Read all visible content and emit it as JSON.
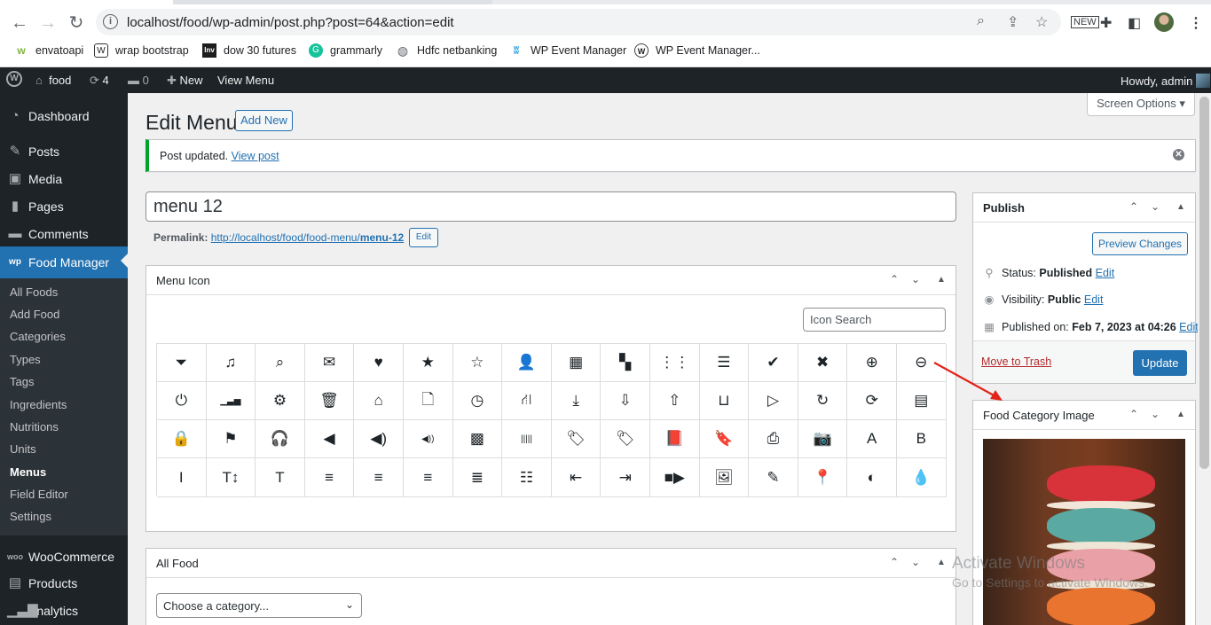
{
  "browser": {
    "url": "localhost/food/wp-admin/post.php?post=64&action=edit",
    "bookmarks": [
      {
        "label": "envatoapi",
        "icon": "envato-icon"
      },
      {
        "label": "wrap bootstrap",
        "icon": "wrap-bootstrap-icon"
      },
      {
        "label": "dow 30 futures",
        "icon": "investing-icon"
      },
      {
        "label": "grammarly",
        "icon": "grammarly-icon"
      },
      {
        "label": "Hdfc netbanking",
        "icon": "globe-icon"
      },
      {
        "label": "WP Event Manager",
        "icon": "wp-event-manager-icon"
      },
      {
        "label": "WP Event Manager...",
        "icon": "wordpress-icon"
      }
    ]
  },
  "admin_bar": {
    "site": "food",
    "updates": "4",
    "comments": "0",
    "new": "New",
    "view": "View Menu",
    "howdy": "Howdy, admin"
  },
  "sidebar": {
    "items": [
      {
        "label": "Dashboard",
        "icon": "dashboard-icon"
      },
      {
        "label": "Posts",
        "icon": "pin-icon"
      },
      {
        "label": "Media",
        "icon": "media-icon"
      },
      {
        "label": "Pages",
        "icon": "page-icon"
      },
      {
        "label": "Comments",
        "icon": "comment-icon"
      },
      {
        "label": "Food Manager",
        "icon": "food-manager-icon"
      }
    ],
    "submenu": [
      "All Foods",
      "Add Food",
      "Categories",
      "Types",
      "Tags",
      "Ingredients",
      "Nutritions",
      "Units",
      "Menus",
      "Field Editor",
      "Settings"
    ],
    "bottom": [
      {
        "label": "WooCommerce",
        "icon": "woo-icon"
      },
      {
        "label": "Products",
        "icon": "products-icon"
      },
      {
        "label": "Analytics",
        "icon": "analytics-icon"
      }
    ]
  },
  "page": {
    "title": "Edit Menu",
    "add_new": "Add New",
    "screen_options": "Screen Options",
    "notice_text": "Post updated.",
    "notice_link": "View post",
    "post_title": "menu 12",
    "permalink_label": "Permalink:",
    "permalink_url": "http://localhost/food/food-menu/",
    "permalink_slug": "menu-12",
    "permalink_edit": "Edit"
  },
  "menu_icon_box": {
    "title": "Menu Icon",
    "search_placeholder": "Icon Search"
  },
  "icons": [
    {
      "name": "filter-icon",
      "glyph": "⏷"
    },
    {
      "name": "music-icon",
      "glyph": "♫"
    },
    {
      "name": "search-icon",
      "glyph": "⌕"
    },
    {
      "name": "envelope-icon",
      "glyph": "✉"
    },
    {
      "name": "heart-icon",
      "glyph": "♥"
    },
    {
      "name": "star-icon",
      "glyph": "★"
    },
    {
      "name": "star-empty-icon",
      "glyph": "☆"
    },
    {
      "name": "user-icon",
      "glyph": "👤"
    },
    {
      "name": "film-icon",
      "glyph": "▦"
    },
    {
      "name": "th-large-icon",
      "glyph": "▚"
    },
    {
      "name": "th-icon",
      "glyph": "⋮⋮"
    },
    {
      "name": "th-list-icon",
      "glyph": "☰"
    },
    {
      "name": "ok-icon",
      "glyph": "✔"
    },
    {
      "name": "remove-icon",
      "glyph": "✖"
    },
    {
      "name": "zoom-in-icon",
      "glyph": "⊕"
    },
    {
      "name": "zoom-out-icon",
      "glyph": "⊖"
    },
    {
      "name": "off-icon",
      "glyph": "⏻"
    },
    {
      "name": "signal-icon",
      "glyph": "▁▃▅"
    },
    {
      "name": "cog-icon",
      "glyph": "⚙"
    },
    {
      "name": "trash-icon",
      "glyph": "🗑"
    },
    {
      "name": "home-icon",
      "glyph": "⌂"
    },
    {
      "name": "file-icon",
      "glyph": "🗋"
    },
    {
      "name": "time-icon",
      "glyph": "◷"
    },
    {
      "name": "road-icon",
      "glyph": "⛙"
    },
    {
      "name": "download-alt-icon",
      "glyph": "⤓"
    },
    {
      "name": "download-icon",
      "glyph": "⇩"
    },
    {
      "name": "upload-icon",
      "glyph": "⇧"
    },
    {
      "name": "inbox-icon",
      "glyph": "⊔"
    },
    {
      "name": "play-circle-icon",
      "glyph": "▷"
    },
    {
      "name": "repeat-icon",
      "glyph": "↻"
    },
    {
      "name": "refresh-icon",
      "glyph": "⟳"
    },
    {
      "name": "list-alt-icon",
      "glyph": "▤"
    },
    {
      "name": "lock-icon",
      "glyph": "🔒"
    },
    {
      "name": "flag-icon",
      "glyph": "⚑"
    },
    {
      "name": "headphones-icon",
      "glyph": "🎧"
    },
    {
      "name": "volume-off-icon",
      "glyph": "◀"
    },
    {
      "name": "volume-down-icon",
      "glyph": "◀)"
    },
    {
      "name": "volume-up-icon",
      "glyph": "◀))"
    },
    {
      "name": "qrcode-icon",
      "glyph": "▩"
    },
    {
      "name": "barcode-icon",
      "glyph": "|||||"
    },
    {
      "name": "tag-icon",
      "glyph": "🏷"
    },
    {
      "name": "tags-icon",
      "glyph": "🏷"
    },
    {
      "name": "book-icon",
      "glyph": "📕"
    },
    {
      "name": "bookmark-icon",
      "glyph": "🔖"
    },
    {
      "name": "print-icon",
      "glyph": "⎙"
    },
    {
      "name": "camera-icon",
      "glyph": "📷"
    },
    {
      "name": "font-icon",
      "glyph": "A"
    },
    {
      "name": "bold-icon",
      "glyph": "B"
    },
    {
      "name": "italic-icon",
      "glyph": "I"
    },
    {
      "name": "text-height-icon",
      "glyph": "T↕"
    },
    {
      "name": "text-width-icon",
      "glyph": "T"
    },
    {
      "name": "align-left-icon",
      "glyph": "≡"
    },
    {
      "name": "align-center-icon",
      "glyph": "≡"
    },
    {
      "name": "align-right-icon",
      "glyph": "≡"
    },
    {
      "name": "align-justify-icon",
      "glyph": "≣"
    },
    {
      "name": "list-icon",
      "glyph": "☷"
    },
    {
      "name": "indent-left-icon",
      "glyph": "⇤"
    },
    {
      "name": "indent-right-icon",
      "glyph": "⇥"
    },
    {
      "name": "facetime-video-icon",
      "glyph": "■▶"
    },
    {
      "name": "picture-icon",
      "glyph": "🖼"
    },
    {
      "name": "pencil-icon",
      "glyph": "✎"
    },
    {
      "name": "map-marker-icon",
      "glyph": "📍"
    },
    {
      "name": "adjust-icon",
      "glyph": "◐"
    },
    {
      "name": "tint-icon",
      "glyph": "💧"
    }
  ],
  "all_food_box": {
    "title": "All Food",
    "select_value": "Choose a category..."
  },
  "publish_box": {
    "title": "Publish",
    "preview": "Preview Changes",
    "status_label": "Status:",
    "status_value": "Published",
    "visibility_label": "Visibility:",
    "visibility_value": "Public",
    "published_label": "Published on:",
    "published_value": "Feb 7, 2023 at 04:26",
    "edit": "Edit",
    "trash": "Move to Trash",
    "update": "Update"
  },
  "category_image_box": {
    "title": "Food Category Image"
  },
  "watermark": {
    "line1": "Activate Windows",
    "line2": "Go to Settings to activate Windows."
  },
  "colors": {
    "wp_dark": "#1d2327",
    "wp_blue": "#2271b1",
    "notice_green": "#00a32a",
    "trash_red": "#b32d2e",
    "annotation_red": "#e2231a"
  }
}
